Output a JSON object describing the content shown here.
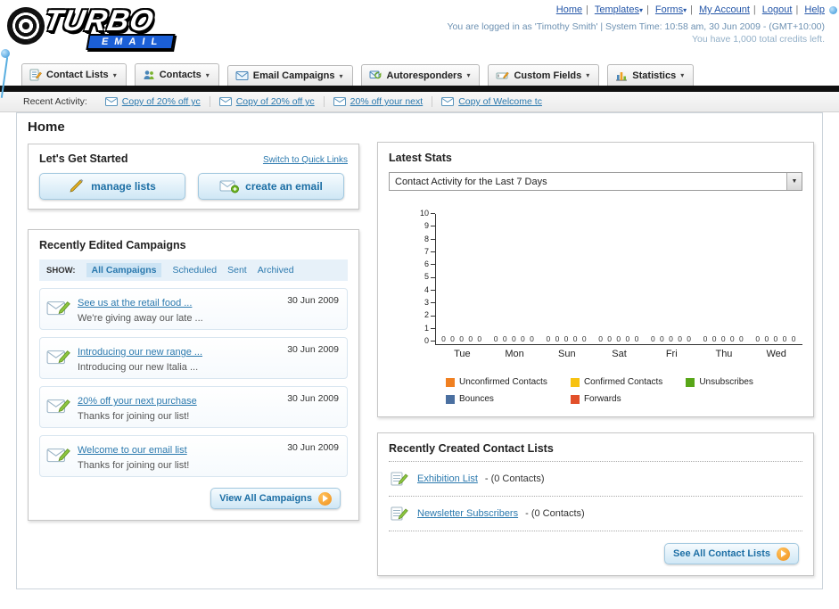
{
  "colors": {
    "link_blue": "#2b79ae",
    "button_blue": "#1d6fa5",
    "accent_orange": "#f09019"
  },
  "header": {
    "logo_top": "TURBO",
    "logo_bottom": "EMAIL",
    "links": [
      {
        "label": "Home",
        "dropdown": false
      },
      {
        "label": "Templates",
        "dropdown": true
      },
      {
        "label": "Forms",
        "dropdown": true
      },
      {
        "label": "My Account",
        "dropdown": false
      },
      {
        "label": "Logout",
        "dropdown": false
      },
      {
        "label": "Help",
        "dropdown": false
      }
    ],
    "login_info": "You are logged in as 'Timothy Smith' | System Time: 10:58 am, 30 Jun 2009 - (GMT+10:00)",
    "credits": "You have 1,000 total credits left."
  },
  "nav_tabs": [
    {
      "label": "Contact Lists"
    },
    {
      "label": "Contacts"
    },
    {
      "label": "Email Campaigns"
    },
    {
      "label": "Autoresponders"
    },
    {
      "label": "Custom Fields"
    },
    {
      "label": "Statistics"
    }
  ],
  "recent_activity": {
    "label": "Recent Activity:",
    "items": [
      {
        "label": "Copy of 20% off yc"
      },
      {
        "label": "Copy of 20% off yc"
      },
      {
        "label": "20% off your next"
      },
      {
        "label": "Copy of Welcome tc"
      }
    ]
  },
  "page_title": "Home",
  "get_started": {
    "title": "Let's Get Started",
    "switch_link": "Switch to Quick Links",
    "manage_lists_label": "manage lists",
    "create_email_label": "create an email"
  },
  "campaigns": {
    "title": "Recently Edited Campaigns",
    "show_label": "SHOW:",
    "filters": [
      {
        "label": "All Campaigns",
        "active": true
      },
      {
        "label": "Scheduled",
        "active": false
      },
      {
        "label": "Sent",
        "active": false
      },
      {
        "label": "Archived",
        "active": false
      }
    ],
    "items": [
      {
        "title": "See us at the retail food ...",
        "subtitle": "We're giving away our late ...",
        "date": "30 Jun 2009"
      },
      {
        "title": "Introducing our new range ...",
        "subtitle": "Introducing our new Italia ...",
        "date": "30 Jun 2009"
      },
      {
        "title": "20% off your next purchase",
        "subtitle": "Thanks for joining our list!",
        "date": "30 Jun 2009"
      },
      {
        "title": "Welcome to our email list",
        "subtitle": "Thanks for joining our list!",
        "date": "30 Jun 2009"
      }
    ],
    "view_all_label": "View All Campaigns"
  },
  "latest_stats": {
    "title": "Latest Stats",
    "dropdown_value": "Contact Activity for the Last 7 Days",
    "chart_data": {
      "type": "bar",
      "title": "Contact Activity for the Last 7 Days",
      "categories": [
        "Tue",
        "Mon",
        "Sun",
        "Sat",
        "Fri",
        "Thu",
        "Wed"
      ],
      "series": [
        {
          "name": "Unconfirmed Contacts",
          "color": "#f08021",
          "values": [
            0,
            0,
            0,
            0,
            0,
            0,
            0
          ]
        },
        {
          "name": "Confirmed Contacts",
          "color": "#f7c211",
          "values": [
            0,
            0,
            0,
            0,
            0,
            0,
            0
          ]
        },
        {
          "name": "Unsubscribes",
          "color": "#58a618",
          "values": [
            0,
            0,
            0,
            0,
            0,
            0,
            0
          ]
        },
        {
          "name": "Bounces",
          "color": "#4a6fa0",
          "values": [
            0,
            0,
            0,
            0,
            0,
            0,
            0
          ]
        },
        {
          "name": "Forwards",
          "color": "#e2502a",
          "values": [
            0,
            0,
            0,
            0,
            0,
            0,
            0
          ]
        }
      ],
      "xlabel": "",
      "ylabel": "",
      "ylim": [
        0,
        10
      ],
      "yticks": [
        10,
        9,
        8,
        7,
        6,
        5,
        4,
        3,
        2,
        1,
        0
      ],
      "grid": false,
      "legend_position": "bottom"
    }
  },
  "contact_lists": {
    "title": "Recently Created Contact Lists",
    "items": [
      {
        "name": "Exhibition List",
        "suffix": "- (0 Contacts)"
      },
      {
        "name": "Newsletter Subscribers",
        "suffix": "- (0 Contacts)"
      }
    ],
    "see_all_label": "See All Contact Lists"
  }
}
